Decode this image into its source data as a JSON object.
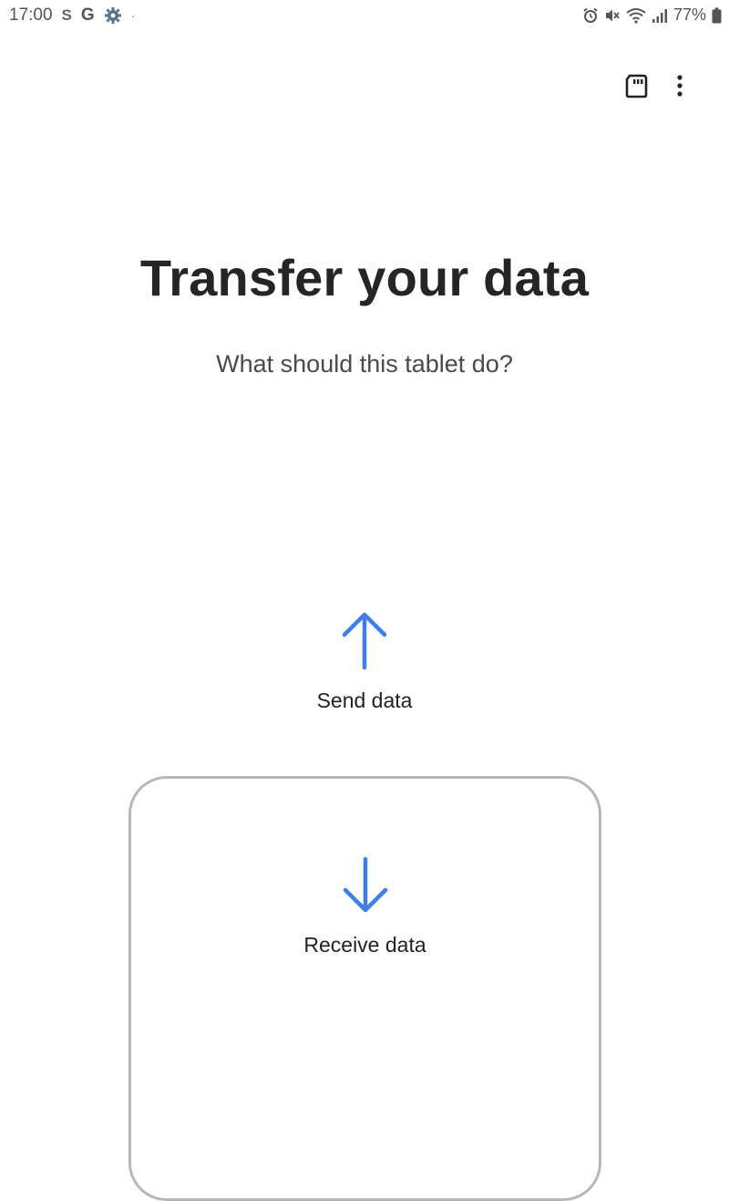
{
  "status_bar": {
    "time": "17:00",
    "notifications": [
      {
        "icon": "s-app-icon",
        "glyph": "S"
      },
      {
        "icon": "google-icon",
        "glyph": "G"
      },
      {
        "icon": "settings-gear-icon"
      },
      {
        "icon": "more-notifications-dot",
        "glyph": "·"
      }
    ],
    "system_icons": [
      "alarm-icon",
      "mute-icon",
      "wifi-icon",
      "signal-icon",
      "battery-icon"
    ],
    "battery_percent": "77%"
  },
  "toolbar": {
    "sd_card_icon": "sd-card-icon",
    "more_icon": "more-vertical-icon"
  },
  "main": {
    "title": "Transfer your data",
    "subtitle": "What should this tablet do?"
  },
  "options": {
    "send": {
      "label": "Send data",
      "icon": "arrow-up-icon"
    },
    "receive": {
      "label": "Receive data",
      "icon": "arrow-down-icon"
    }
  },
  "colors": {
    "accent_blue": "#3f7ee8",
    "card_border": "#b3b9bb",
    "title_text": "#252525"
  }
}
